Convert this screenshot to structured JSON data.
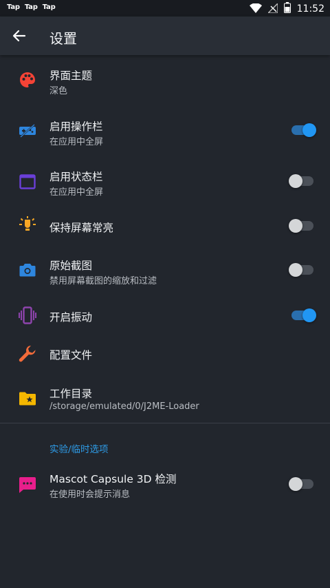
{
  "statusbar": {
    "apps": [
      "Tap",
      "Tap",
      "Tap"
    ],
    "time": "11:52"
  },
  "toolbar": {
    "title": "设置"
  },
  "settings": {
    "theme": {
      "title": "界面主题",
      "subtitle": "深色",
      "icon": "palette-icon"
    },
    "actionbar": {
      "title": "启用操作栏",
      "subtitle": "在应用中全屏",
      "enabled": true,
      "icon": "gamepad-icon"
    },
    "statusbar": {
      "title": "启用状态栏",
      "subtitle": "在应用中全屏",
      "enabled": false,
      "icon": "window-icon"
    },
    "keep_screen": {
      "title": "保持屏幕常亮",
      "enabled": false,
      "icon": "lightbulb-icon"
    },
    "raw_screenshot": {
      "title": "原始截图",
      "subtitle": "禁用屏幕截图的缩放和过滤",
      "enabled": false,
      "icon": "camera-icon"
    },
    "vibration": {
      "title": "开启振动",
      "enabled": true,
      "icon": "vibration-icon"
    },
    "profiles": {
      "title": "配置文件",
      "icon": "wrench-icon"
    },
    "workdir": {
      "title": "工作目录",
      "subtitle": "/storage/emulated/0/J2ME-Loader",
      "icon": "folder-star-icon"
    }
  },
  "experimental": {
    "header": "实验/临时选项",
    "mascot": {
      "title": "Mascot Capsule 3D 检测",
      "subtitle": "在使用时会提示消息",
      "enabled": false,
      "icon": "message-icon"
    }
  },
  "colors": {
    "accent": "#2196f3",
    "background": "#22262d",
    "toolbar": "#292e36"
  }
}
